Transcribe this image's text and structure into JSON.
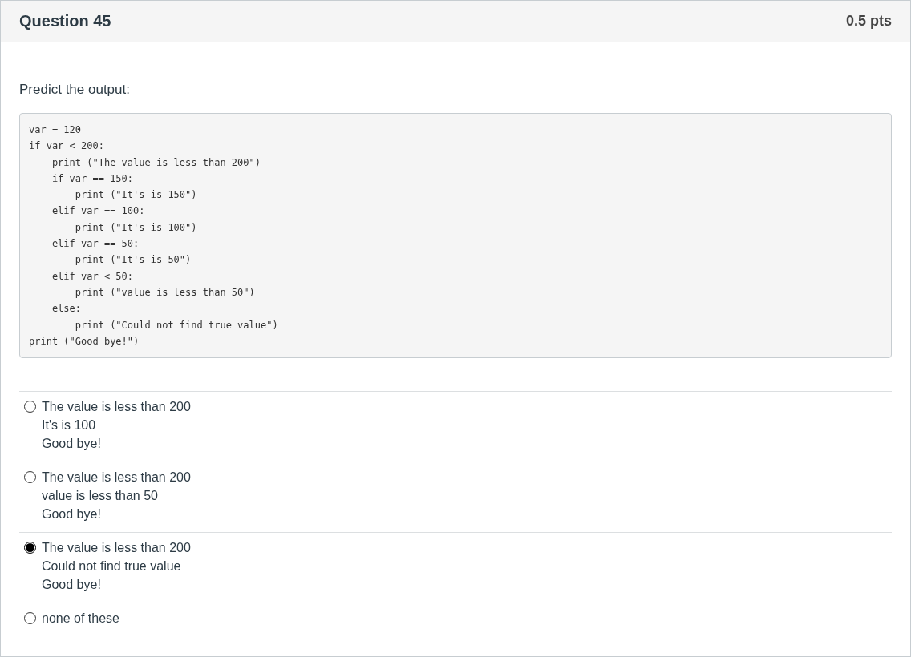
{
  "question": {
    "title": "Question 45",
    "points": "0.5 pts"
  },
  "prompt": "Predict the output:",
  "code": "var = 120\nif var < 200:\n    print (\"The value is less than 200\")\n    if var == 150:\n        print (\"It's is 150\")\n    elif var == 100:\n        print (\"It's is 100\")\n    elif var == 50:\n        print (\"It's is 50\")\n    elif var < 50:\n        print (\"value is less than 50\")\n    else:\n        print (\"Could not find true value\")\nprint (\"Good bye!\")",
  "answers": [
    {
      "text": "The value is less than 200\nIt's is 100\nGood bye!",
      "selected": false
    },
    {
      "text": "The value is less than 200\nvalue is less than 50\nGood bye!",
      "selected": false
    },
    {
      "text": "The value is less than 200\nCould not find true value\nGood bye!",
      "selected": true
    },
    {
      "text": "none of these",
      "selected": false
    }
  ]
}
